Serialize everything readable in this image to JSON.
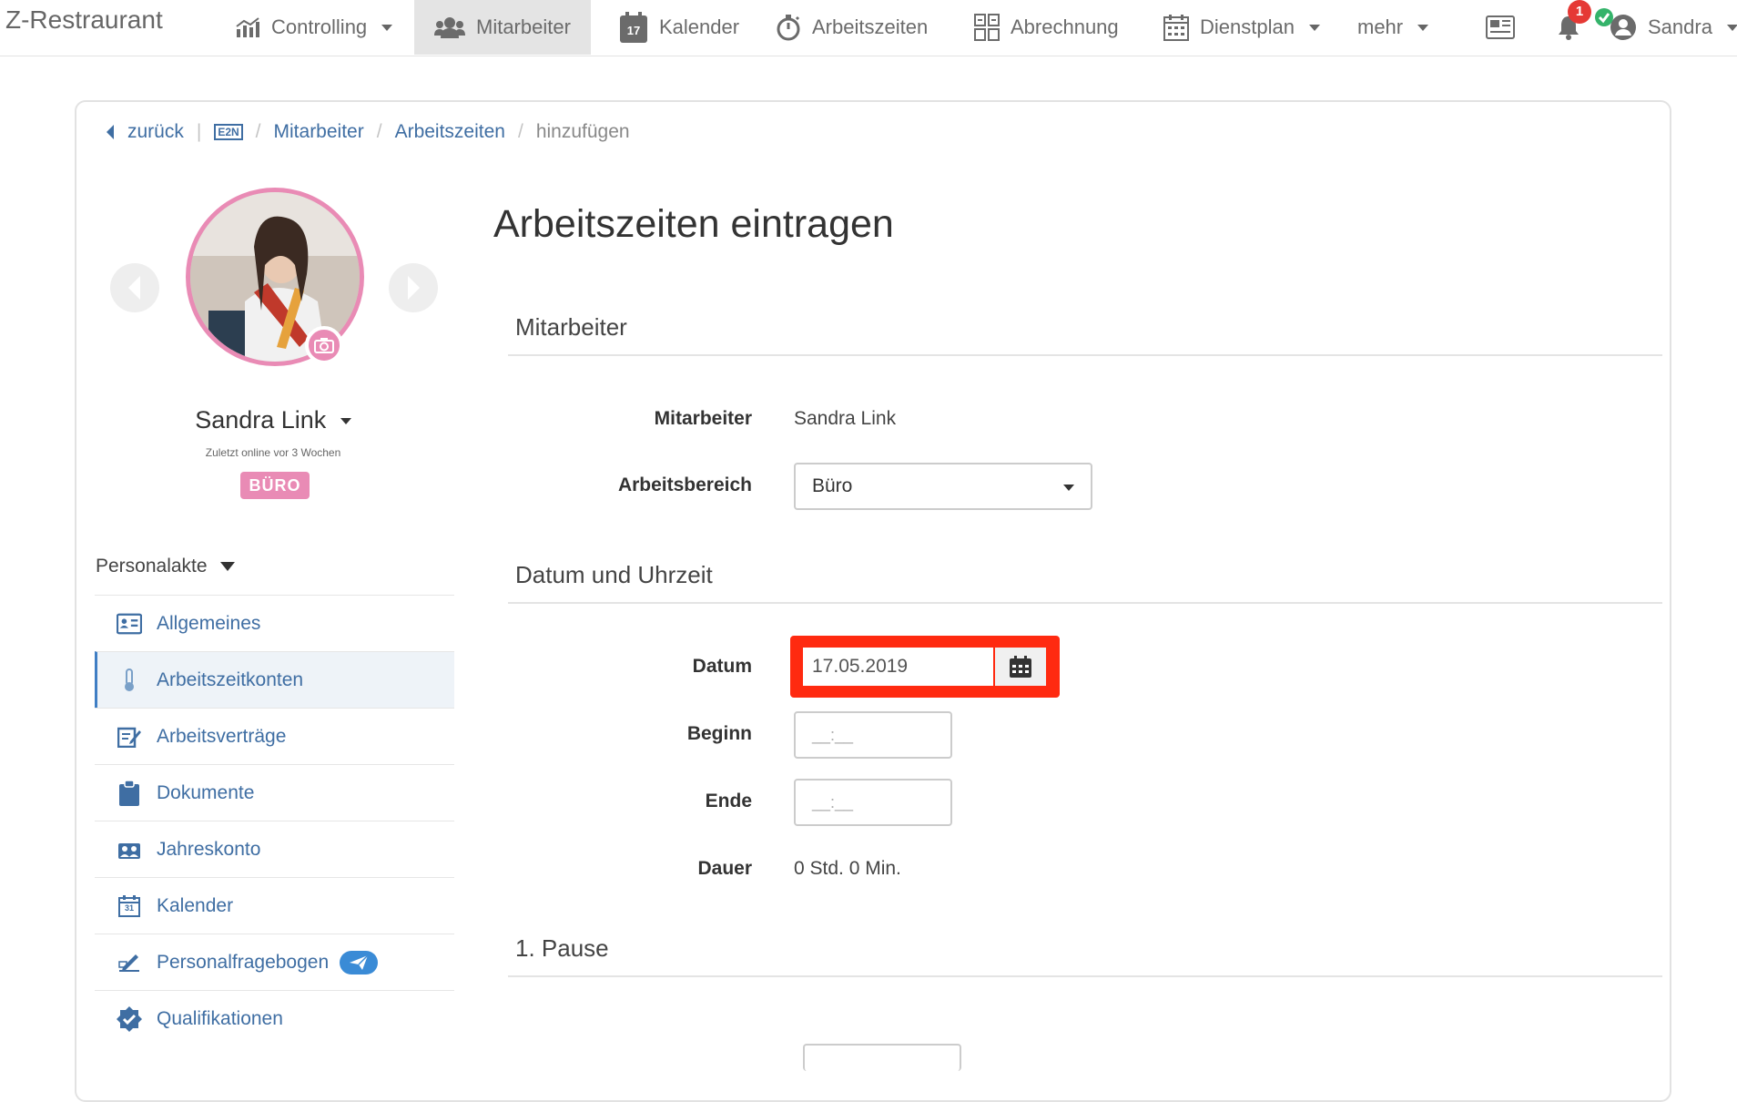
{
  "brand": "Z-Restraurant",
  "nav": {
    "controlling": "Controlling",
    "mitarbeiter": "Mitarbeiter",
    "kalender": "Kalender",
    "kalender_icon_day": "17",
    "arbeitszeiten": "Arbeitszeiten",
    "abrechnung": "Abrechnung",
    "dienstplan": "Dienstplan",
    "mehr": "mehr",
    "notification_count": "1",
    "user": "Sandra"
  },
  "breadcrumb": {
    "back": "zurück",
    "pipe": "|",
    "e2n": "E2N",
    "items": [
      "Mitarbeiter",
      "Arbeitszeiten"
    ],
    "current": "hinzufügen",
    "sep": "/"
  },
  "profile": {
    "name": "Sandra Link",
    "last_online": "Zuletzt online vor 3 Wochen",
    "department": "BÜRO"
  },
  "sidebar": {
    "section": "Personalakte",
    "items": [
      {
        "label": "Allgemeines",
        "icon": "id-card-icon"
      },
      {
        "label": "Arbeitszeitkonten",
        "icon": "thermometer-icon"
      },
      {
        "label": "Arbeitsverträge",
        "icon": "contract-edit-icon"
      },
      {
        "label": "Dokumente",
        "icon": "clipboard-icon"
      },
      {
        "label": "Jahreskonto",
        "icon": "people-group-icon"
      },
      {
        "label": "Kalender",
        "icon": "calendar-icon",
        "icon_day": "31"
      },
      {
        "label": "Personalfragebogen",
        "icon": "pen-sign-icon"
      },
      {
        "label": "Qualifikationen",
        "icon": "badge-check-icon"
      }
    ],
    "active_index": 1
  },
  "main": {
    "title": "Arbeitszeiten eintragen",
    "sections": {
      "mitarbeiter": "Mitarbeiter",
      "datum": "Datum und Uhrzeit",
      "pause": "1. Pause"
    },
    "fields": {
      "mitarbeiter_label": "Mitarbeiter",
      "mitarbeiter_value": "Sandra Link",
      "bereich_label": "Arbeitsbereich",
      "bereich_value": "Büro",
      "datum_label": "Datum",
      "datum_value": "17.05.2019",
      "beginn_label": "Beginn",
      "beginn_placeholder": "__:__",
      "ende_label": "Ende",
      "ende_placeholder": "__:__",
      "dauer_label": "Dauer",
      "dauer_value": "0 Std. 0 Min."
    }
  },
  "colors": {
    "accent": "#3f6ea3",
    "highlight": "#ff2a10",
    "pink": "#e98bb5",
    "notification": "#e53935"
  }
}
